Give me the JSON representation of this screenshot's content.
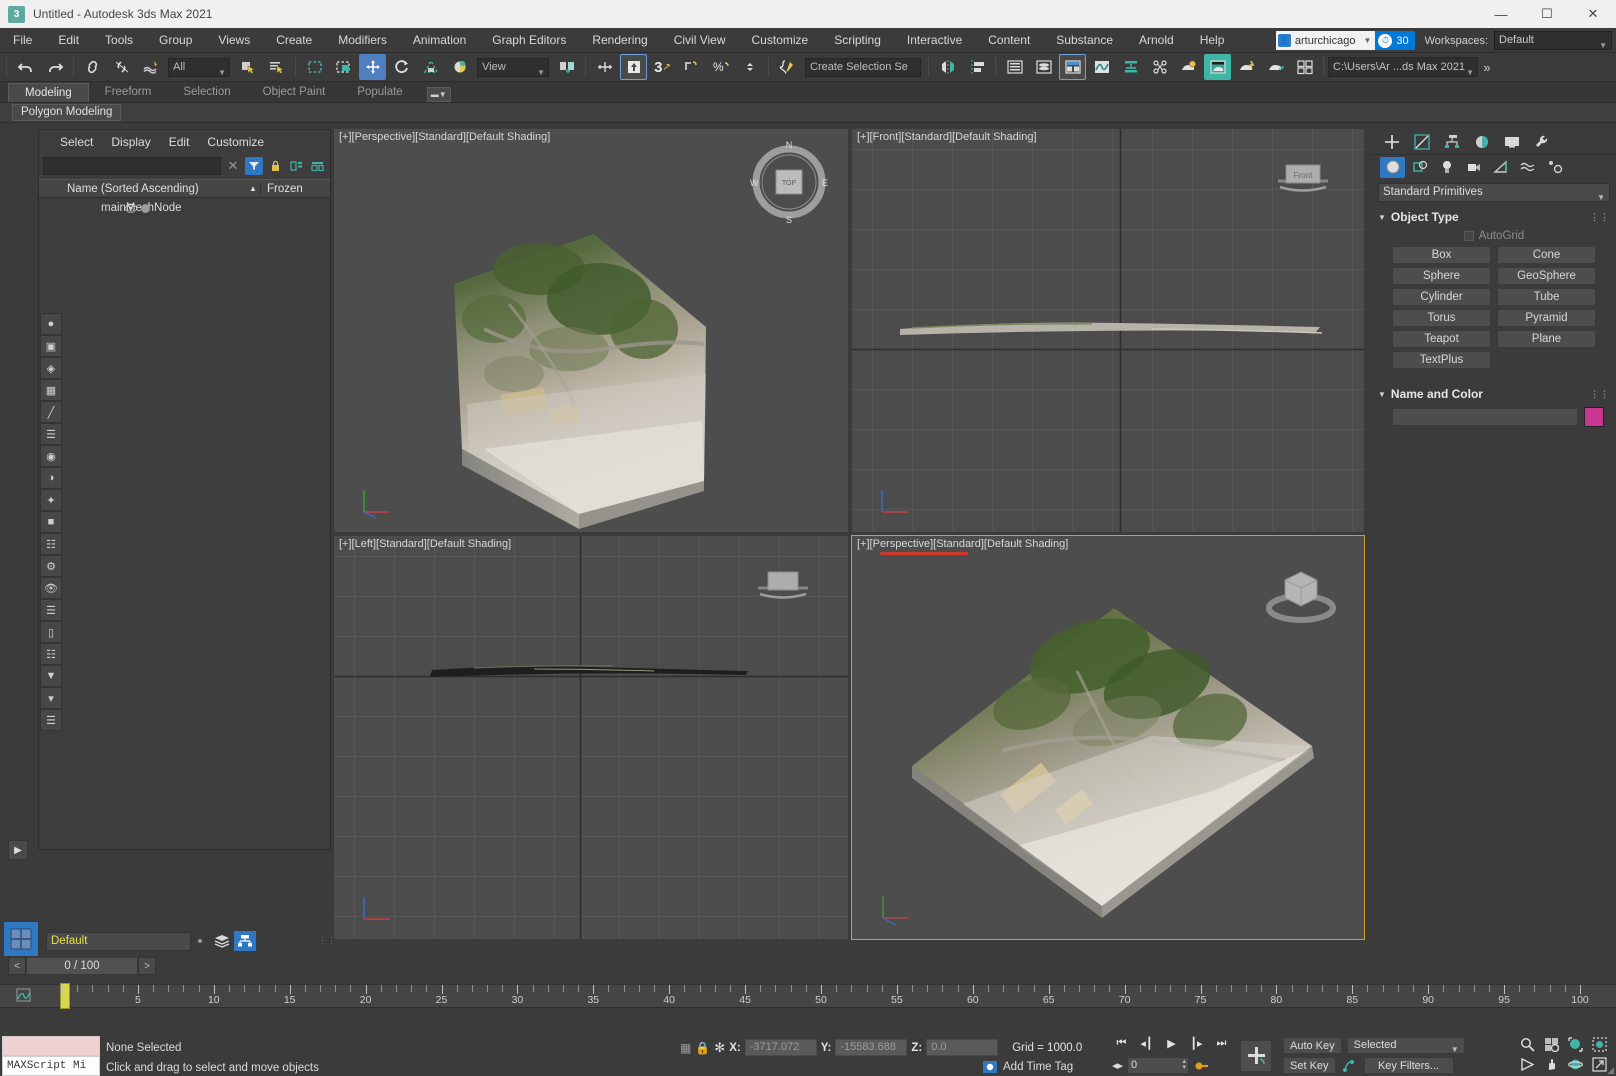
{
  "window": {
    "title": "Untitled - Autodesk 3ds Max 2021",
    "app_icon": "3",
    "minimize": "—",
    "maximize": "☐",
    "close": "✕"
  },
  "menubar": {
    "items": [
      "File",
      "Edit",
      "Tools",
      "Group",
      "Views",
      "Create",
      "Modifiers",
      "Animation",
      "Graph Editors",
      "Rendering",
      "Civil View",
      "Customize",
      "Scripting",
      "Interactive",
      "Content",
      "Substance",
      "Arnold",
      "Help"
    ],
    "user_name": "arturchicago",
    "clock_value": "30",
    "workspaces_label": "Workspaces:",
    "workspace_value": "Default"
  },
  "toolbar": {
    "undo": "undo-arrow",
    "redo": "redo-arrow",
    "select_link": "select-and-link",
    "unlink": "unlink-selection",
    "bind_space_warp": "bind-to-space-warp",
    "selection_filter": "All",
    "select_object": "select-object",
    "select_by_name": "select-by-name",
    "rect_select_region": "rectangular-selection-region",
    "window_crossing": "window-crossing",
    "select_move": "select-and-move",
    "select_rotate": "select-and-rotate",
    "select_scale": "select-and-uniform-scale",
    "placement": "select-and-place",
    "ref_coord_system": "View",
    "use_center": "use-pivot-point-center",
    "select_and_manipulate": "select-and-manipulate",
    "snaps_toggle": "snaps-toggle-3",
    "angle_snap": "angle-snap-toggle",
    "percent_snap": "percent-snap-toggle",
    "spinner_snap": "spinner-snap-toggle",
    "named_selection_sets": "edit-named-selection-sets",
    "selection_set_placeholder": "Create Selection Se",
    "mirror": "mirror",
    "align": "align",
    "layer_explorer": "layer-explorer",
    "scene_explorer": "scene-explorer",
    "ribbon_toggle": "toggle-ribbon",
    "curve_editor": "curve-editor",
    "schematic_view": "schematic-view",
    "material_editor": "material-editor",
    "render_setup": "render-setup",
    "rendered_frame": "rendered-frame-window",
    "render_production": "render-production",
    "render_iterative": "render-iterative",
    "project_folder": "project-folder",
    "project_path": "C:\\Users\\Ar ...ds Max 2021",
    "overflow": "»"
  },
  "ribbon": {
    "tabs": [
      "Modeling",
      "Freeform",
      "Selection",
      "Object Paint",
      "Populate"
    ],
    "active_tab": "Modeling",
    "subtitle": "Polygon Modeling"
  },
  "explorer": {
    "menus": [
      "Select",
      "Display",
      "Edit",
      "Customize"
    ],
    "search_value": "",
    "clear_icon": "✕",
    "filter_icon": "funnel-icon",
    "lock_icon": "lock-icon",
    "expand_icon": "expand-all-icon",
    "collapse_icon": "collapse-all-icon",
    "columns": [
      "Name (Sorted Ascending)",
      "Frozen"
    ],
    "sort_caret": "▲",
    "rows": [
      {
        "name": "mainMeshNode",
        "visible": true,
        "frozen": false
      }
    ]
  },
  "viewports": [
    {
      "id": "vp-top-left",
      "label_bracket": "[+]",
      "view": "[Perspective]",
      "shading_std": "[Standard]",
      "shading": "[Default Shading]",
      "active": false,
      "nav_widget": "compass-view-cube"
    },
    {
      "id": "vp-top-right",
      "label_bracket": "[+]",
      "view": "[Front]",
      "shading_std": "[Standard]",
      "shading": "[Default Shading]",
      "active": false,
      "nav_widget": "view-cube"
    },
    {
      "id": "vp-bottom-left",
      "label_bracket": "[+]",
      "view": "[Left]",
      "shading_std": "[Standard]",
      "shading": "[Default Shading]",
      "active": false,
      "nav_widget": "view-cube"
    },
    {
      "id": "vp-bottom-right",
      "label_bracket": "[+]",
      "view": "[Perspective]",
      "shading_std": "[Standard]",
      "shading": "[Default Shading]",
      "active": true,
      "nav_widget": "view-cube"
    }
  ],
  "command_panel": {
    "tabs": [
      "create-tab",
      "modify-tab",
      "hierarchy-tab",
      "motion-tab",
      "display-tab",
      "utilities-tab"
    ],
    "active_tab": "create-tab",
    "category_buttons": [
      "geometry-icon",
      "shapes-icon",
      "lights-icon",
      "cameras-icon",
      "helpers-icon",
      "space-warps-icon",
      "systems-icon"
    ],
    "active_category": "geometry-icon",
    "subcategory": "Standard Primitives",
    "object_type": {
      "title": "Object Type",
      "autogrid_label": "AutoGrid",
      "autogrid_checked": false,
      "buttons": [
        "Box",
        "Cone",
        "Sphere",
        "GeoSphere",
        "Cylinder",
        "Tube",
        "Torus",
        "Pyramid",
        "Teapot",
        "Plane",
        "TextPlus"
      ]
    },
    "name_and_color": {
      "title": "Name and Color",
      "name_value": "",
      "color": "#c8368f"
    }
  },
  "animation_bar": {
    "layer_name": "Default",
    "layer_icon": "layers-icon",
    "layer_manager_icon": "layer-manager-icon",
    "time_field": "0 / 100",
    "prev_frame": "<",
    "next_frame": ">"
  },
  "trackbar": {
    "tick_labels": [
      "5",
      "10",
      "15",
      "20",
      "25",
      "30",
      "35",
      "40",
      "45",
      "50",
      "55",
      "60",
      "65",
      "70",
      "75",
      "80",
      "85",
      "90",
      "95",
      "100"
    ],
    "current_frame": 0
  },
  "statusbar": {
    "maxscript_listener_label": "MAXScript Mi",
    "selection_status": "None Selected",
    "prompt": "Click and drag to select and move objects",
    "lock_selection_icon": "lock-selection-icon",
    "absolute_mode_icon": "absolute-mode-transform-icon",
    "coords": {
      "x_label": "X:",
      "x": "-3717.072",
      "y_label": "Y:",
      "y": "-15583.688",
      "z_label": "Z:",
      "z": "0.0"
    },
    "grid": "Grid = 1000.0",
    "add_time_tag": "Add Time Tag",
    "add_time_tag_icon": "time-tag-icon"
  },
  "playback": {
    "go_to_start": "⏮",
    "previous_frame": "◀",
    "play": "▶",
    "next_frame": "▶",
    "go_to_end": "⏭",
    "key_mode_icon": "key-mode-toggle",
    "current_frame": "0",
    "auto_key": "Auto Key",
    "set_key": "Set Key",
    "key_filter_selection": "Selected",
    "key_filters": "Key Filters...",
    "set_key_icon": "set-key-icon",
    "big_key_icon": "set-keys-icon"
  },
  "nav_controls": {
    "zoom": "zoom-icon",
    "zoom_all": "zoom-all-icon",
    "zoom_extents": "zoom-extents-icon",
    "zoom_region": "zoom-region-icon",
    "field_of_view": "field-of-view-icon",
    "pan": "pan-hand-icon",
    "orbit": "orbit-icon",
    "maximize_viewport": "maximize-viewport-toggle"
  },
  "colors": {
    "accent_blue": "#2f78c4",
    "active_viewport": "#c9a227",
    "layer_text": "#e2e246",
    "name_color_swatch": "#c8368f",
    "red_annotation": "#d03a2a"
  }
}
